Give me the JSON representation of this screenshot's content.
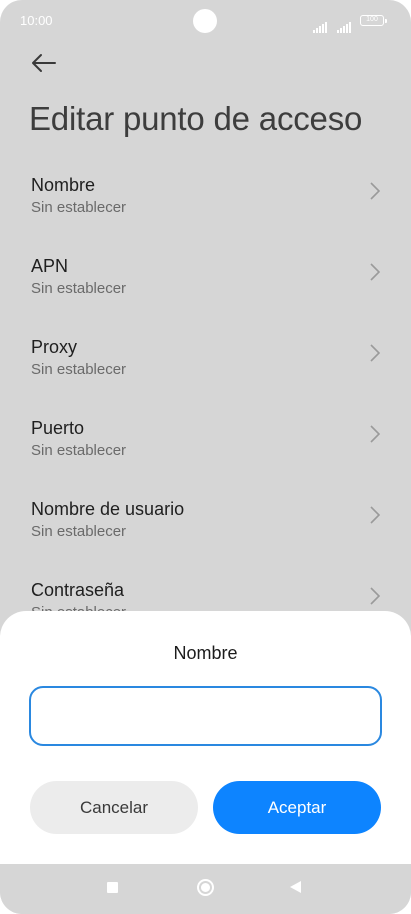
{
  "status": {
    "time": "10:00",
    "battery": "100"
  },
  "header": {
    "title": "Editar punto de acceso",
    "back_icon": "arrow-left-icon"
  },
  "settings": [
    {
      "title": "Nombre",
      "value": "Sin establecer"
    },
    {
      "title": "APN",
      "value": "Sin establecer"
    },
    {
      "title": "Proxy",
      "value": "Sin establecer"
    },
    {
      "title": "Puerto",
      "value": "Sin establecer"
    },
    {
      "title": "Nombre de usuario",
      "value": "Sin establecer"
    },
    {
      "title": "Contraseña",
      "value": "Sin establecer"
    }
  ],
  "dialog": {
    "title": "Nombre",
    "input_value": "",
    "cancel_label": "Cancelar",
    "accept_label": "Aceptar"
  },
  "colors": {
    "background_dim": "#d6d6d6",
    "accent": "#0d84ff",
    "input_border": "#2a88e0"
  }
}
